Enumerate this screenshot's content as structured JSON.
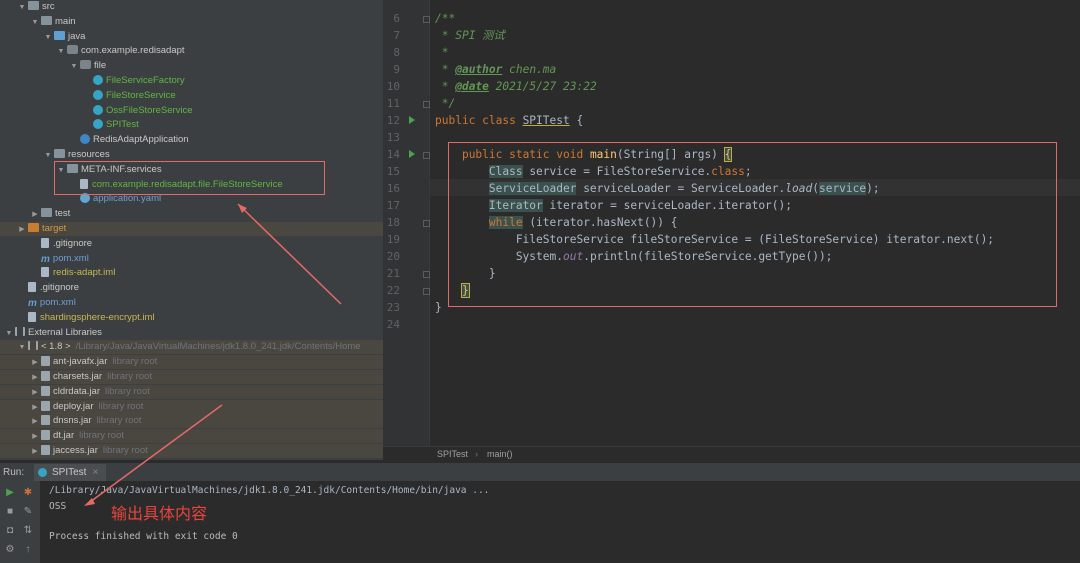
{
  "tree": [
    {
      "label": "src",
      "indent": 1,
      "icon": "folder",
      "tw": "▼",
      "cls": "t-white"
    },
    {
      "label": "main",
      "indent": 2,
      "icon": "folder",
      "tw": "▼",
      "cls": "t-white"
    },
    {
      "label": "java",
      "indent": 3,
      "icon": "folder blue",
      "tw": "▼",
      "cls": "t-white"
    },
    {
      "label": "com.example.redisadapt",
      "indent": 4,
      "icon": "pkg",
      "tw": "▼",
      "cls": "t-white"
    },
    {
      "label": "file",
      "indent": 5,
      "icon": "pkg",
      "tw": "▼",
      "cls": "t-white"
    },
    {
      "label": "FileServiceFactory",
      "indent": 6,
      "icon": "cls",
      "tw": "",
      "cls": "t-green"
    },
    {
      "label": "FileStoreService",
      "indent": 6,
      "icon": "cls",
      "tw": "",
      "cls": "t-green"
    },
    {
      "label": "OssFileStoreService",
      "indent": 6,
      "icon": "cls",
      "tw": "",
      "cls": "t-green"
    },
    {
      "label": "SPITest",
      "indent": 6,
      "icon": "cls",
      "tw": "",
      "cls": "t-green"
    },
    {
      "label": "RedisAdaptApplication",
      "indent": 5,
      "icon": "app",
      "tw": "",
      "cls": "t-white"
    },
    {
      "label": "resources",
      "indent": 3,
      "icon": "folder",
      "tw": "▼",
      "cls": "t-white"
    },
    {
      "label": "META-INF.services",
      "indent": 4,
      "icon": "folder",
      "tw": "▼",
      "cls": "t-white"
    },
    {
      "label": "com.example.redisadapt.file.FileStoreService",
      "indent": 5,
      "icon": "file",
      "tw": "",
      "cls": "t-green"
    },
    {
      "label": "application.yaml",
      "indent": 5,
      "icon": "yaml",
      "tw": "",
      "cls": "t-blue"
    },
    {
      "label": "test",
      "indent": 2,
      "icon": "folder",
      "tw": "▶",
      "cls": "t-white"
    },
    {
      "label": "target",
      "indent": 1,
      "icon": "folder orange",
      "tw": "▶",
      "cls": "t-orange",
      "row": "hl"
    },
    {
      "label": ".gitignore",
      "indent": 2,
      "icon": "file",
      "tw": "",
      "cls": "t-white"
    },
    {
      "label": "pom.xml",
      "indent": 2,
      "icon": "m",
      "tw": "",
      "cls": "t-blue"
    },
    {
      "label": "redis-adapt.iml",
      "indent": 2,
      "icon": "file",
      "tw": "",
      "cls": "t-yellow"
    },
    {
      "label": ".gitignore",
      "indent": 1,
      "icon": "file",
      "tw": "",
      "cls": "t-white"
    },
    {
      "label": "pom.xml",
      "indent": 1,
      "icon": "m",
      "tw": "",
      "cls": "t-blue"
    },
    {
      "label": "shardingsphere-encrypt.iml",
      "indent": 1,
      "icon": "file",
      "tw": "",
      "cls": "t-yellow"
    },
    {
      "label": "External Libraries",
      "indent": 0,
      "icon": "lib",
      "tw": "▼",
      "cls": "t-white"
    },
    {
      "label": "< 1.8 >",
      "sub": "/Library/Java/JavaVirtualMachines/jdk1.8.0_241.jdk/Contents/Home",
      "indent": 1,
      "icon": "lib",
      "tw": "▼",
      "cls": "t-white",
      "row": "hl"
    },
    {
      "label": "ant-javafx.jar",
      "sub": "library root",
      "indent": 2,
      "icon": "jar",
      "tw": "▶",
      "cls": "t-white",
      "row": "hl"
    },
    {
      "label": "charsets.jar",
      "sub": "library root",
      "indent": 2,
      "icon": "jar",
      "tw": "▶",
      "cls": "t-white",
      "row": "hl"
    },
    {
      "label": "cldrdata.jar",
      "sub": "library root",
      "indent": 2,
      "icon": "jar",
      "tw": "▶",
      "cls": "t-white",
      "row": "hl"
    },
    {
      "label": "deploy.jar",
      "sub": "library root",
      "indent": 2,
      "icon": "jar",
      "tw": "▶",
      "cls": "t-white",
      "row": "hl"
    },
    {
      "label": "dnsns.jar",
      "sub": "library root",
      "indent": 2,
      "icon": "jar",
      "tw": "▶",
      "cls": "t-white",
      "row": "hl"
    },
    {
      "label": "dt.jar",
      "sub": "library root",
      "indent": 2,
      "icon": "jar",
      "tw": "▶",
      "cls": "t-white",
      "row": "hl"
    },
    {
      "label": "jaccess.jar",
      "sub": "library root",
      "indent": 2,
      "icon": "jar",
      "tw": "▶",
      "cls": "t-white",
      "row": "hl"
    }
  ],
  "editor": {
    "line_numbers": [
      "6",
      "7",
      "8",
      "9",
      "10",
      "11",
      "12",
      "13",
      "14",
      "15",
      "16",
      "17",
      "18",
      "19",
      "20",
      "21",
      "22",
      "23",
      "24"
    ],
    "comment_title": "SPI 测试",
    "author_tag": "@author",
    "author": "chen.ma",
    "date_tag": "@date",
    "date": "2021/5/27 23:22",
    "class_name": "SPITest"
  },
  "breadcrumb": {
    "class": "SPITest",
    "method": "main()"
  },
  "run": {
    "label": "Run:",
    "tab": "SPITest",
    "cmd": "/Library/Java/JavaVirtualMachines/jdk1.8.0_241.jdk/Contents/Home/bin/java ...",
    "output": "OSS",
    "exit": "Process finished with exit code 0",
    "annotation": "输出具体内容"
  },
  "colors": {
    "accent_red": "#e36a67",
    "class_green": "#62b543",
    "keyword_orange": "#cc7832"
  }
}
